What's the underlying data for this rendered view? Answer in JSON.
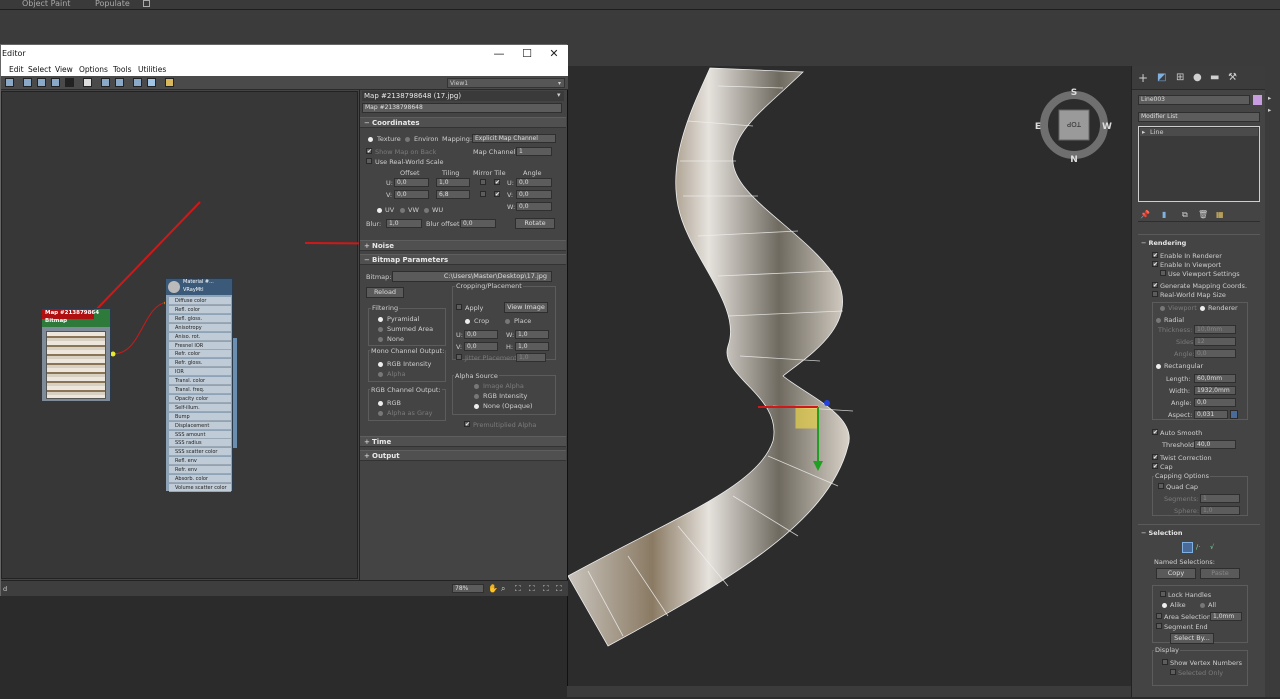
{
  "top": {
    "items": [
      "Object Paint",
      "Populate"
    ]
  },
  "editor": {
    "title": "Editor",
    "window_buttons": {
      "minimize": "—",
      "maximize": "☐",
      "close": "✕"
    },
    "menu": [
      "Edit",
      "Select",
      "View",
      "Options",
      "Tools",
      "Utilities"
    ],
    "view_dropdown": "View1",
    "status_text": "d",
    "zoom": "78%"
  },
  "params": {
    "map_title": "Map #2138798648 (17.jpg)",
    "map_name": "Map #2138798648",
    "coordinates": {
      "header": "Coordinates",
      "texture": "Texture",
      "environ": "Environ",
      "mapping_label": "Mapping:",
      "mapping_value": "Explicit Map Channel",
      "show_map_on_back": "Show Map on Back",
      "map_channel_label": "Map Channel:",
      "map_channel_value": "1",
      "use_real_world": "Use Real-World Scale",
      "col_offset": "Offset",
      "col_tiling": "Tiling",
      "col_mirror_tile": "Mirror Tile",
      "col_angle": "Angle",
      "u_label": "U:",
      "v_label": "V:",
      "w_label": "W:",
      "u_offset": "0,0",
      "v_offset": "0,0",
      "u_tiling": "1,0",
      "v_tiling": "6,8",
      "u_angle": "0,0",
      "v_angle": "0,0",
      "w_angle": "0,0",
      "uv": "UV",
      "vw": "VW",
      "wu": "WU",
      "blur_label": "Blur:",
      "blur_value": "1,0",
      "blur_offset_label": "Blur offset:",
      "blur_offset_value": "0,0",
      "rotate": "Rotate"
    },
    "noise": "Noise",
    "bitmap_params": {
      "header": "Bitmap Parameters",
      "bitmap_label": "Bitmap:",
      "bitmap_path": "C:\\Users\\Master\\Desktop\\17.jpg",
      "reload": "Reload",
      "cropping_title": "Cropping/Placement",
      "apply": "Apply",
      "view_image": "View Image",
      "crop": "Crop",
      "place": "Place",
      "u": "U:",
      "v": "V:",
      "w": "W:",
      "h": "H:",
      "cu": "0,0",
      "cv": "0,0",
      "cw": "1,0",
      "ch": "1,0",
      "jitter_label": "Jitter Placement:",
      "jitter_value": "1,0",
      "filtering_title": "Filtering",
      "pyramidal": "Pyramidal",
      "summed_area": "Summed Area",
      "none": "None",
      "mono_title": "Mono Channel Output:",
      "rgb_intensity": "RGB Intensity",
      "alpha": "Alpha",
      "rgb_channel_title": "RGB Channel Output:",
      "rgb": "RGB",
      "alpha_as_gray": "Alpha as Gray",
      "alpha_source_title": "Alpha Source",
      "image_alpha": "Image Alpha",
      "as_rgb_intensity": "RGB Intensity",
      "none_opaque": "None (Opaque)",
      "premultiplied": "Premultiplied Alpha"
    },
    "time": "Time",
    "output": "Output"
  },
  "nodes": {
    "bitmap_node": {
      "title": "Map #213879864",
      "subtitle": "Bitmap"
    },
    "material_node": {
      "title": "Material #...",
      "subtitle": "VRayMtl",
      "slots": [
        "Diffuse color",
        "Refl. color",
        "Refl. gloss.",
        "Anisotropy",
        "Aniso. rot.",
        "Fresnel IOR",
        "Refr. color",
        "Refr. gloss.",
        "IOR",
        "Transl. color",
        "Transl. freq.",
        "Opacity color",
        "Self-illum.",
        "Bump",
        "Displacement",
        "SSS amount",
        "SSS radius",
        "SSS scatter color",
        "Refl. env",
        "Refr. env",
        "Absorb. color",
        "Volume scatter color"
      ]
    }
  },
  "viewport": {
    "viewcube_face": "TOP",
    "compass": {
      "n": "N",
      "s": "S",
      "e": "E",
      "w": "W"
    }
  },
  "command_panel": {
    "object_name": "Line003",
    "modifier_list": "Modifier List",
    "stack_item": "Line",
    "rendering": {
      "header": "Rendering",
      "enable_renderer": "Enable In Renderer",
      "enable_viewport": "Enable In Viewport",
      "use_viewport_settings": "Use Viewport Settings",
      "generate_mapping": "Generate Mapping Coords.",
      "real_world_map": "Real-World Map Size",
      "viewport": "Viewport",
      "renderer": "Renderer",
      "radial": "Radial",
      "thickness_label": "Thickness:",
      "thickness": "10,0mm",
      "sides_label": "Sides:",
      "sides": "12",
      "angle_label": "Angle:",
      "angle": "0,0",
      "rectangular": "Rectangular",
      "length_label": "Length:",
      "length": "60,0mm",
      "width_label": "Width:",
      "width": "1932,0mm",
      "angle2_label": "Angle:",
      "angle2": "0,0",
      "aspect_label": "Aspect:",
      "aspect": "0,031",
      "auto_smooth": "Auto Smooth",
      "threshold_label": "Threshold:",
      "threshold": "40,0",
      "twist": "Twist Correction",
      "cap": "Cap",
      "capping_options": "Capping Options",
      "quad_cap": "Quad Cap",
      "segments_label": "Segments:",
      "segments": "1",
      "sphere_label": "Sphere:",
      "sphere": "1,0"
    },
    "selection": {
      "header": "Selection",
      "named_selections": "Named Selections:",
      "copy": "Copy",
      "paste": "Paste",
      "lock_handles": "Lock Handles",
      "alike": "Alike",
      "all": "All",
      "area_selection": "Area Selection:",
      "area_value": "1,0mm",
      "segment_end": "Segment End",
      "select_by": "Select By...",
      "display": "Display",
      "show_vertex_numbers": "Show Vertex Numbers",
      "selected_only": "Selected Only"
    }
  },
  "colors": {
    "accent": "#d9b03a",
    "selection_yellow": "#e8d24a",
    "arrow_red": "#d01818",
    "object_swatch": "#c79de0"
  }
}
